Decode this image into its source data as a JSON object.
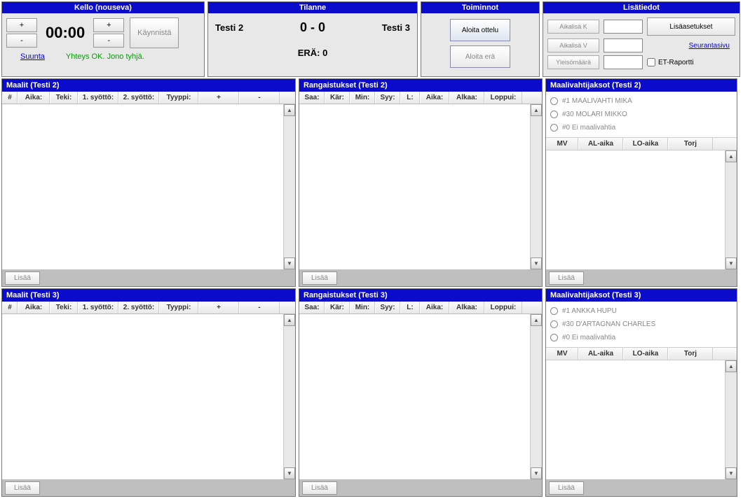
{
  "kello": {
    "header": "Kello (nouseva)",
    "plus": "+",
    "minus": "-",
    "time": "00:00",
    "kaynnista": "Käynnistä",
    "suunta": "Suunta",
    "status": "Yhteys OK. Jono tyhjä."
  },
  "tilanne": {
    "header": "Tilanne",
    "home": "Testi 2",
    "score": "0 - 0",
    "away": "Testi 3",
    "era": "ERÄ: 0"
  },
  "toiminnot": {
    "header": "Toiminnot",
    "aloita_ottelu": "Aloita ottelu",
    "aloita_era": "Aloita erä"
  },
  "lisatiedot": {
    "header": "Lisätiedot",
    "aikalisa_k": "Aikalisä K",
    "aikalisa_v": "Aikalisä V",
    "yleisomaara": "Yleisömäärä",
    "lisaasetukset": "Lisäasetukset",
    "seurantasivu": "Seurantasivu",
    "etraportti": "ET-Raportti"
  },
  "maalit": {
    "header_home": "Maalit (Testi 2)",
    "header_away": "Maalit (Testi 3)",
    "cols": [
      "#",
      "Aika:",
      "Teki:",
      "1. syöttö:",
      "2. syöttö:",
      "Tyyppi:",
      "+",
      "-"
    ]
  },
  "rangaistukset": {
    "header_home": "Rangaistukset (Testi 2)",
    "header_away": "Rangaistukset (Testi 3)",
    "cols": [
      "Saa:",
      "Kär:",
      "Min:",
      "Syy:",
      "L:",
      "Aika:",
      "Alkaa:",
      "Loppui:"
    ]
  },
  "maalivahti": {
    "header_home": "Maalivahtijaksot (Testi 2)",
    "header_away": "Maalivahtijaksot (Testi 3)",
    "cols": [
      "MV",
      "AL-aika",
      "LO-aika",
      "Torj"
    ],
    "goalies_home": [
      "#1 MAALIVAHTI MIKA",
      "#30 MOLARI MIKKO",
      "#0 Ei maalivahtia"
    ],
    "goalies_away": [
      "#1 ANKKA HUPU",
      "#30 D'ARTAGNAN CHARLES",
      "#0 Ei maalivahtia"
    ]
  },
  "common": {
    "lisaa": "Lisää"
  }
}
